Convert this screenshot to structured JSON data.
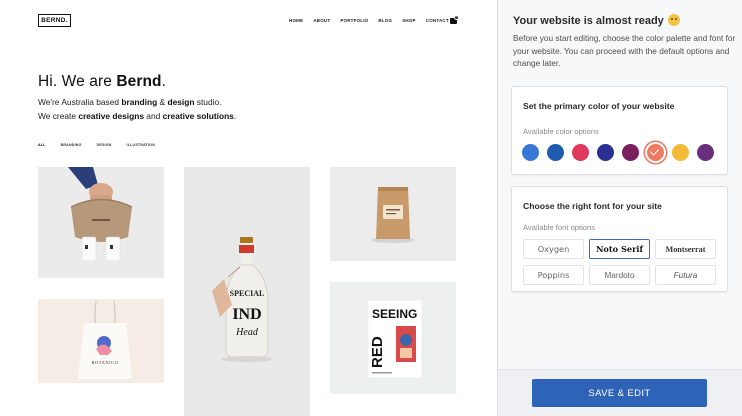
{
  "preview": {
    "logo": "BERND.",
    "nav": [
      "HOME",
      "ABOUT",
      "PORTFOLIO",
      "BLOG",
      "SHOP",
      "CONTACT"
    ],
    "cart_count": "0",
    "hero": {
      "title_prefix": "Hi. We are ",
      "title_name": "Bernd",
      "title_suffix": ".",
      "line1_prefix": "We're Australia based ",
      "line1_bold1": "branding",
      "line1_mid": " & ",
      "line1_bold2": "design",
      "line1_suffix": " studio.",
      "line2_prefix": "We create ",
      "line2_bold1": "creative designs",
      "line2_mid": " and ",
      "line2_bold2": "creative solutions",
      "line2_suffix": "."
    },
    "filters": [
      "ALL",
      "BRANDING",
      "DESIGN",
      "ILLUSTRATION"
    ],
    "portfolio": {
      "bottle_label_1": "SPECIAL",
      "bottle_label_2": "IND",
      "bottle_label_3": "Head",
      "tote_label": "BOTANICO",
      "poster_line1": "SEEING",
      "poster_line2": "RED"
    }
  },
  "panel": {
    "title": "Your website is almost ready",
    "description": "Before you start editing, choose the color palette and font for your website. You can proceed with the default options and change later.",
    "color_card": {
      "title": "Set the primary color of your website",
      "subtitle": "Available color options",
      "colors": [
        "#3a78d6",
        "#1f5cb0",
        "#df3a5e",
        "#2b2f93",
        "#7a1f5e",
        "#ee7a63",
        "#f2ba36",
        "#6a2f7c"
      ],
      "selected_index": 5
    },
    "font_card": {
      "title": "Choose the right font for your site",
      "subtitle": "Available font options",
      "fonts": [
        "Oxygen",
        "Noto Serif",
        "Montserrat",
        "Poppins",
        "Mardoto",
        "Futura"
      ],
      "selected": "Noto Serif"
    },
    "save_label": "SAVE & EDIT"
  }
}
